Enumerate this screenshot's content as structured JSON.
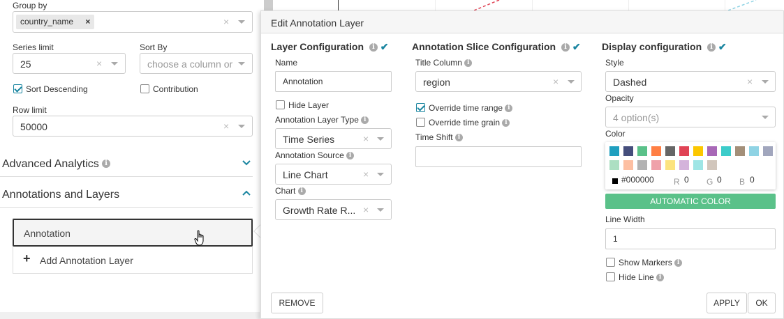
{
  "controls": {
    "group_by_label": "Group by",
    "group_by_tag": "country_name",
    "group_by_tag_remove": "×",
    "series_limit_label": "Series limit",
    "series_limit_value": "25",
    "sort_by_label": "Sort By",
    "sort_by_placeholder": "choose a column or",
    "sort_descending_label": "Sort Descending",
    "sort_descending_checked": true,
    "contribution_label": "Contribution",
    "contribution_checked": false,
    "row_limit_label": "Row limit",
    "row_limit_value": "50000",
    "clear_glyph": "×"
  },
  "sections": {
    "advanced_analytics": "Advanced Analytics",
    "annotations_layers": "Annotations and Layers"
  },
  "annotations_panel": {
    "items": [
      {
        "label": "Annotation"
      }
    ],
    "add_label": "Add Annotation Layer",
    "add_glyph": "+"
  },
  "modal": {
    "title": "Edit Annotation Layer",
    "layer_config": {
      "title": "Layer Configuration",
      "name_label": "Name",
      "name_value": "Annotation",
      "hide_layer_label": "Hide Layer",
      "hide_layer_checked": false,
      "type_label": "Annotation Layer Type",
      "type_value": "Time Series",
      "source_label": "Annotation Source",
      "source_value": "Line Chart",
      "chart_label": "Chart",
      "chart_value": "Growth Rate R..."
    },
    "slice_config": {
      "title": "Annotation Slice Configuration",
      "title_column_label": "Title Column",
      "title_column_value": "region",
      "override_time_range_label": "Override time range",
      "override_time_range_checked": true,
      "override_time_grain_label": "Override time grain",
      "override_time_grain_checked": false,
      "time_shift_label": "Time Shift",
      "time_shift_value": ""
    },
    "display_config": {
      "title": "Display configuration",
      "style_label": "Style",
      "style_value": "Dashed",
      "opacity_label": "Opacity",
      "opacity_placeholder": "4 option(s)",
      "color_label": "Color",
      "swatches_row1": [
        "#1f9fbf",
        "#454e7c",
        "#5ac189",
        "#ff7f44",
        "#666666",
        "#e04355",
        "#fcc700",
        "#a868b7",
        "#3cccca",
        "#a38f79",
        "#8fd3e4",
        "#a1a6bd"
      ],
      "swatches_row2": [
        "#acdfc2",
        "#fdbfa2",
        "#b2b2b2",
        "#efa1aa",
        "#fce37f",
        "#d4b3db",
        "#9ee5e5",
        "#d1c6bc"
      ],
      "hex_value": "#000000",
      "r_label": "R",
      "r_value": "0",
      "g_label": "G",
      "g_value": "0",
      "b_label": "B",
      "b_value": "0",
      "auto_color_label": "AUTOMATIC COLOR",
      "line_width_label": "Line Width",
      "line_width_value": "1",
      "show_markers_label": "Show Markers",
      "show_markers_checked": false,
      "hide_line_label": "Hide Line",
      "hide_line_checked": false
    },
    "buttons": {
      "remove": "REMOVE",
      "apply": "APPLY",
      "ok": "OK"
    }
  },
  "colors": {
    "accent": "#1a85a0",
    "auto_color_bg": "#5ac189",
    "info_icon": "#aaaaaa",
    "chart_line_red": "#e04355",
    "chart_line_blue": "#8fd3e4"
  }
}
